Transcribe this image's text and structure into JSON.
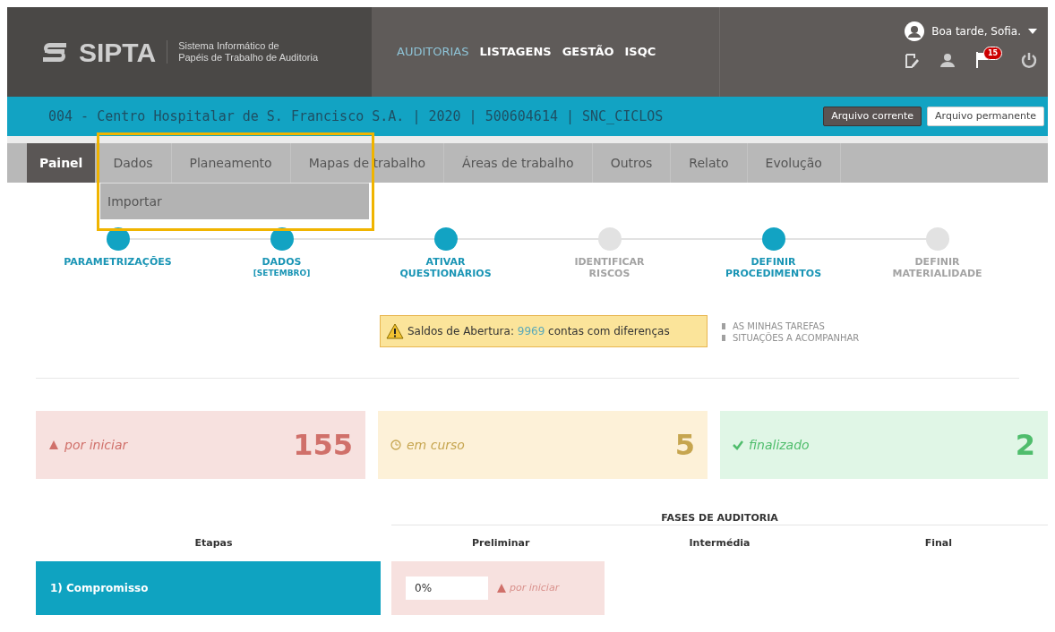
{
  "header": {
    "logo": "SIPTA",
    "subtitle": [
      "Sistema Informático de",
      "Papéis de Trabalho de Auditoria"
    ],
    "nav": [
      {
        "label": "AUDITORIAS",
        "selected": true
      },
      {
        "label": "LISTAGENS",
        "selected": false
      },
      {
        "label": "GESTÃO",
        "selected": false
      },
      {
        "label": "ISQC",
        "selected": false
      }
    ],
    "greeting": "Boa tarde, Sofia.",
    "notifications": "15"
  },
  "context_bar": {
    "title": "004 - Centro Hospitalar de S. Francisco S.A. | 2020 | 500604614 | SNC_CICLOS",
    "archives": [
      {
        "label": "Arquivo corrente",
        "selected": true
      },
      {
        "label": "Arquivo permanente",
        "selected": false
      }
    ]
  },
  "tabs": [
    {
      "label": "Painel",
      "selected": true
    },
    {
      "label": "Dados",
      "selected": false
    },
    {
      "label": "Planeamento",
      "selected": false
    },
    {
      "label": "Mapas de trabalho",
      "selected": false
    },
    {
      "label": "Áreas de trabalho",
      "selected": false
    },
    {
      "label": "Outros",
      "selected": false
    },
    {
      "label": "Relato",
      "selected": false
    },
    {
      "label": "Evolução",
      "selected": false
    }
  ],
  "dropdown": {
    "items": [
      "Importar"
    ]
  },
  "steps": [
    {
      "label": [
        "PARAMETRIZAÇÕES"
      ],
      "active": true
    },
    {
      "label": [
        "DADOS"
      ],
      "note": "[SETEMBRO]",
      "active": true
    },
    {
      "label": [
        "ATIVAR",
        "QUESTIONÁRIOS"
      ],
      "active": true
    },
    {
      "label": [
        "IDENTIFICAR",
        "RISCOS"
      ],
      "active": false
    },
    {
      "label": [
        "DEFINIR",
        "PROCEDIMENTOS"
      ],
      "active": true
    },
    {
      "label": [
        "DEFINIR",
        "MATERIALIDADE"
      ],
      "active": false
    }
  ],
  "alert": {
    "prefix": "Saldos de Abertura:",
    "count": "9969",
    "suffix": "contas com diferenças"
  },
  "links": [
    "AS MINHAS TAREFAS",
    "SITUAÇÕES A ACOMPANHAR"
  ],
  "status_cards": [
    {
      "kind": "pending",
      "label": "por iniciar",
      "count": "155"
    },
    {
      "kind": "progress",
      "label": "em curso",
      "count": "5"
    },
    {
      "kind": "done",
      "label": "finalizado",
      "count": "2"
    }
  ],
  "phases_table": {
    "group_title": "FASES DE AUDITORIA",
    "columns": [
      "Etapas",
      "Preliminar",
      "Intermédia",
      "Final"
    ],
    "rows": [
      {
        "stage": "1) Compromisso",
        "value": "0%",
        "status": "por iniciar"
      }
    ]
  }
}
